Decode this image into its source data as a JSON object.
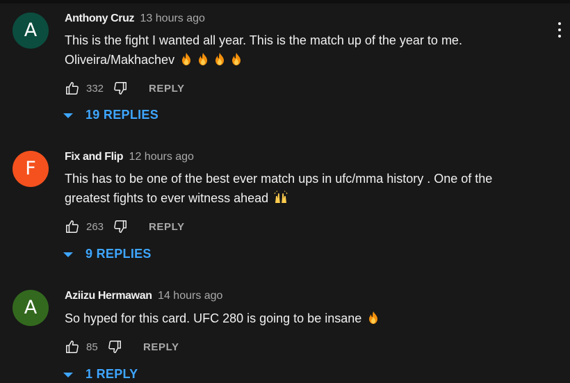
{
  "colors": {
    "background": "#181818",
    "accent": "#3ea6ff",
    "text": "#f1f1f1",
    "muted": "#aaaaaa"
  },
  "comments": [
    {
      "avatar_letter": "A",
      "avatar_color": "#0b4d3f",
      "author": "Anthony Cruz",
      "time": "13 hours ago",
      "lines": [
        "This is the fight I wanted all year. This is the match up of the year to me.",
        "Oliveira/Makhachev"
      ],
      "emojis": "fire x4",
      "likes": "332",
      "reply_label": "REPLY",
      "replies_label": "19 REPLIES"
    },
    {
      "avatar_letter": "F",
      "avatar_color": "#f4511e",
      "author": "Fix and Flip",
      "time": "12 hours ago",
      "lines": [
        "This has to be one of the best ever match ups in ufc/mma history . One of the",
        "greatest fights to ever witness ahead"
      ],
      "emojis": "raising-hands",
      "likes": "263",
      "reply_label": "REPLY",
      "replies_label": "9 REPLIES"
    },
    {
      "avatar_letter": "A",
      "avatar_color": "#33691e",
      "author": "Aziizu Hermawan",
      "time": "14 hours ago",
      "lines": [
        "So hyped for this card. UFC 280 is going to be insane"
      ],
      "emojis": "fire",
      "likes": "85",
      "reply_label": "REPLY",
      "replies_label": "1 REPLY"
    }
  ],
  "icons": [
    "like-icon",
    "dislike-icon",
    "caret-down-icon",
    "more-vert-icon",
    "fire-emoji",
    "raising-hands-emoji"
  ]
}
